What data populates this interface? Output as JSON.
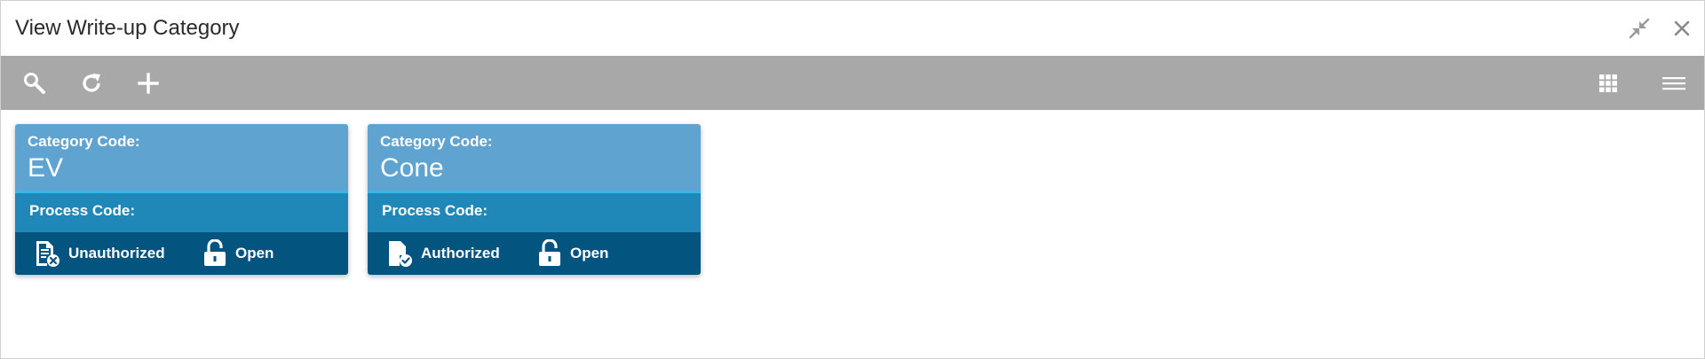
{
  "window": {
    "title": "View Write-up Category",
    "controls": [
      "minimize-icon",
      "close-icon"
    ]
  },
  "toolbar": {
    "left_icons": [
      "search-icon",
      "refresh-icon",
      "add-icon"
    ],
    "right_icons": [
      "grid-view-icon",
      "list-view-icon"
    ]
  },
  "tiles": [
    {
      "code_label": "Category Code:",
      "code_value": "EV",
      "process_label": "Process Code:",
      "auth_status": "Unauthorized",
      "lock_status": "Open"
    },
    {
      "code_label": "Category Code:",
      "code_value": "Cone",
      "process_label": "Process Code:",
      "auth_status": "Authorized",
      "lock_status": "Open"
    }
  ],
  "colors": {
    "toolbar_bg": "#a8a8a8",
    "tile_head": "#5fa3d1",
    "tile_accent": "#33b9e8",
    "tile_mid": "#2088b8",
    "tile_foot": "#03557f"
  }
}
